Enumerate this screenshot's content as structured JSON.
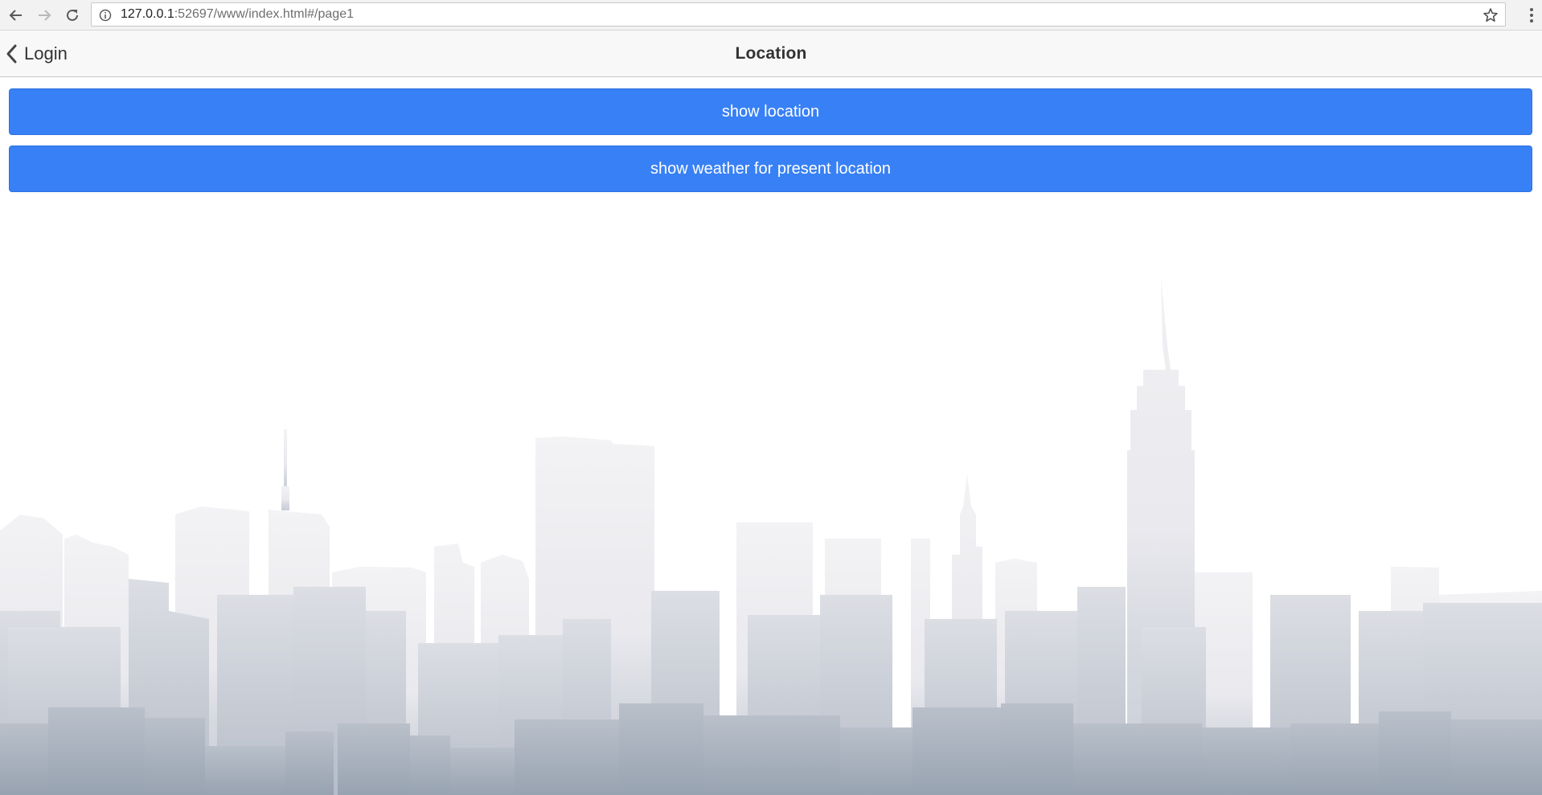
{
  "browser": {
    "url_host": "127.0.0.1",
    "url_rest": ":52697/www/index.html#/page1",
    "icons": {
      "back": "arrow-left-icon",
      "forward": "arrow-right-icon",
      "reload": "reload-icon",
      "info": "info-icon",
      "bookmark": "star-icon",
      "menu": "kebab-menu-icon"
    }
  },
  "header": {
    "back_label": "Login",
    "title": "Location"
  },
  "buttons": {
    "show_location": "show location",
    "show_weather": "show weather for present location"
  },
  "colors": {
    "primary": "#3880f5",
    "header_bg": "#f8f8f8",
    "skyline_top": "#e8e8ec",
    "skyline_bottom": "#97a3b1"
  }
}
